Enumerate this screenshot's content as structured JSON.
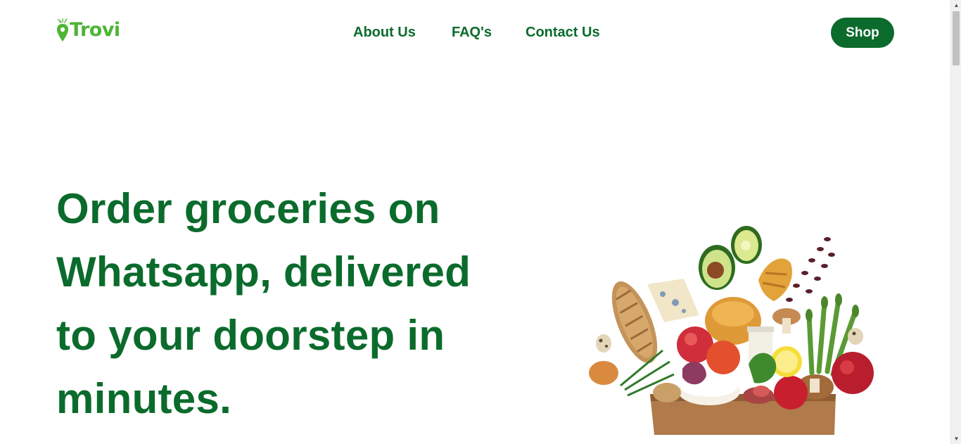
{
  "brand": {
    "name": "Trovi",
    "logo_icon": "carrot-pin-icon",
    "color_primary": "#0b6b2c",
    "color_logo": "#4cb535"
  },
  "nav": {
    "items": [
      {
        "label": "About Us"
      },
      {
        "label": "FAQ's"
      },
      {
        "label": "Contact Us"
      }
    ],
    "shop_label": "Shop"
  },
  "hero": {
    "title": "Order groceries on Whatsapp, delivered to your doorstep in minutes.",
    "image_description_icon": "grocery-bag-illustration"
  },
  "scrollbar": {
    "up_icon": "arrow-up-icon",
    "down_icon": "arrow-down-icon"
  }
}
